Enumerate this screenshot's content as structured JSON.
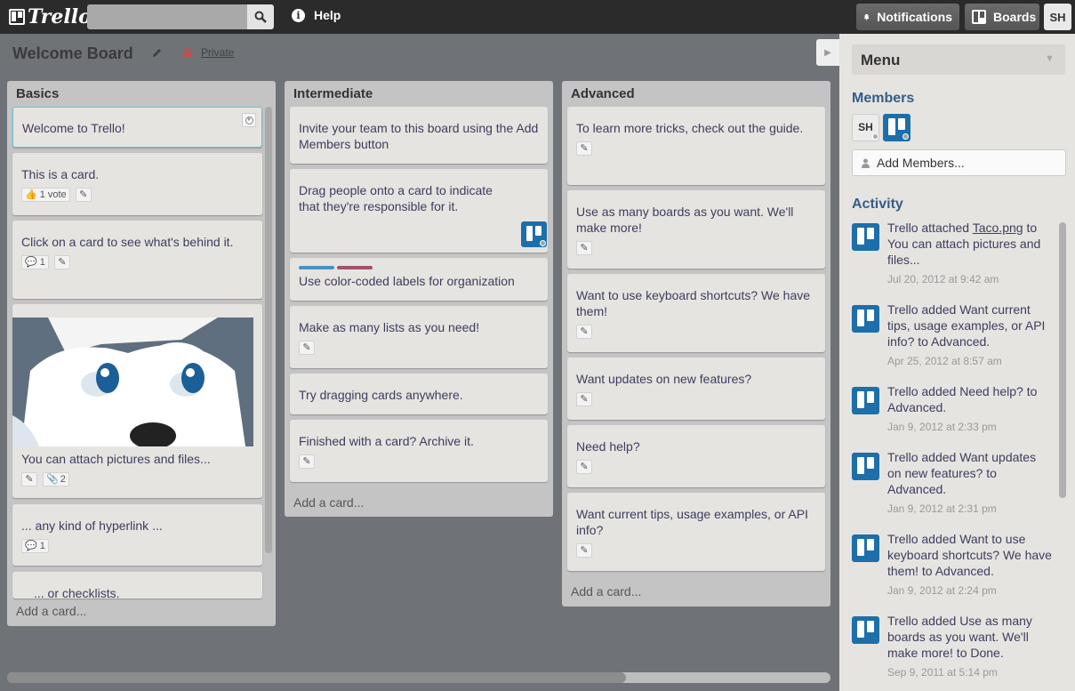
{
  "topbar": {
    "logo_text": "Trello",
    "help_label": "Help",
    "notifications_label": "Notifications",
    "boards_label": "Boards",
    "user_initials": "SH"
  },
  "board": {
    "title": "Welcome Board",
    "visibility": "Private"
  },
  "lists": [
    {
      "title": "Basics",
      "cards": [
        {
          "text": "Welcome to Trello!"
        },
        {
          "text": "This is a card.",
          "votes": "1 vote"
        },
        {
          "text": "Click on a card to see what's behind it.",
          "comments": "1"
        },
        {
          "text": "You can attach pictures and files...",
          "attachments": "2"
        },
        {
          "text": "... any kind of hyperlink ...",
          "comments": "1"
        },
        {
          "text": "... or checklists."
        }
      ],
      "add_card": "Add a card..."
    },
    {
      "title": "Intermediate",
      "cards": [
        {
          "text": "Invite your team to this board using the Add Members button"
        },
        {
          "text": "Drag people onto a card to indicate that they're responsible for it."
        },
        {
          "text": "Use color-coded labels for organization"
        },
        {
          "text": "Make as many lists as you need!"
        },
        {
          "text": "Try dragging cards anywhere."
        },
        {
          "text": "Finished with a card? Archive it."
        }
      ],
      "add_card": "Add a card..."
    },
    {
      "title": "Advanced",
      "cards": [
        {
          "text": "To learn more tricks, check out the guide."
        },
        {
          "text": "Use as many boards as you want. We'll make more!"
        },
        {
          "text": "Want to use keyboard shortcuts? We have them!"
        },
        {
          "text": "Want updates on new features?"
        },
        {
          "text": "Need help?"
        },
        {
          "text": "Want current tips, usage examples, or API info?"
        }
      ],
      "add_card": "Add a card..."
    }
  ],
  "sidebar": {
    "menu_title": "Menu",
    "members_title": "Members",
    "member_initials": "SH",
    "add_members_label": "Add Members...",
    "activity_title": "Activity",
    "activity": [
      {
        "pre": "Trello attached ",
        "link": "Taco.png",
        "post": " to You can attach pictures and files...",
        "date": "Jul 20, 2012 at 9:42 am"
      },
      {
        "pre": "Trello added Want current tips, usage examples, or API info? to Advanced.",
        "link": "",
        "post": "",
        "date": "Apr 25, 2012 at 8:57 am"
      },
      {
        "pre": "Trello added Need help? to Advanced.",
        "link": "",
        "post": "",
        "date": "Jan 9, 2012 at 2:33 pm"
      },
      {
        "pre": "Trello added Want updates on new features? to Advanced.",
        "link": "",
        "post": "",
        "date": "Jan 9, 2012 at 2:31 pm"
      },
      {
        "pre": "Trello added Want to use keyboard shortcuts? We have them! to Advanced.",
        "link": "",
        "post": "",
        "date": "Jan 9, 2012 at 2:24 pm"
      },
      {
        "pre": "Trello added Use as many boards as you want. We'll make more! to Done.",
        "link": "",
        "post": "",
        "date": "Sep 9, 2011 at 5:14 pm"
      }
    ]
  },
  "colors": {
    "topbar": "#2b2b2b",
    "board_bg": "#6f7377",
    "list_bg": "#c4c4c4",
    "card_bg": "#e6e4e1",
    "sidebar_heading": "#355d88",
    "avatar_blue": "#1c6fa8",
    "label_blue": "#4a90c4",
    "label_red": "#a0526b"
  }
}
